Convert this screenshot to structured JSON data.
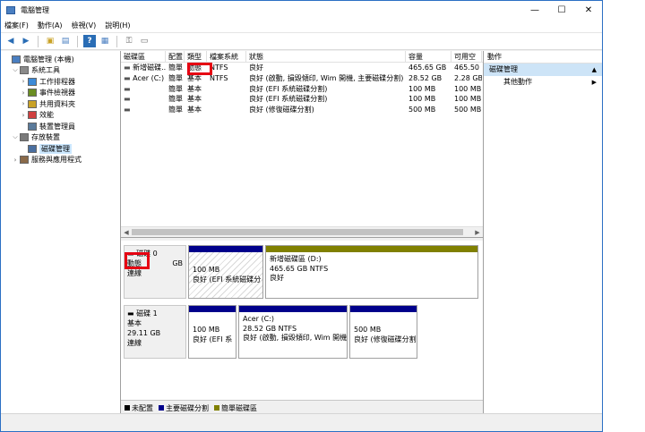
{
  "window": {
    "title": "電腦管理"
  },
  "menu": [
    "檔案(F)",
    "動作(A)",
    "檢視(V)",
    "說明(H)"
  ],
  "tree": [
    {
      "label": "電腦管理 (本機)",
      "arrow": "",
      "indent": 0,
      "icon": "computer-management-icon"
    },
    {
      "label": "系統工具",
      "arrow": "⌵",
      "indent": 1,
      "icon": "tools-icon"
    },
    {
      "label": "工作排程器",
      "arrow": "›",
      "indent": 2,
      "icon": "clock-icon"
    },
    {
      "label": "事件檢視器",
      "arrow": "›",
      "indent": 2,
      "icon": "event-viewer-icon"
    },
    {
      "label": "共用資料夾",
      "arrow": "›",
      "indent": 2,
      "icon": "shared-folder-icon"
    },
    {
      "label": "效能",
      "arrow": "›",
      "indent": 2,
      "icon": "performance-icon"
    },
    {
      "label": "裝置管理員",
      "arrow": "",
      "indent": 2,
      "icon": "device-manager-icon"
    },
    {
      "label": "存放裝置",
      "arrow": "⌵",
      "indent": 1,
      "icon": "storage-icon"
    },
    {
      "label": "磁碟管理",
      "arrow": "",
      "indent": 2,
      "icon": "disk-management-icon"
    },
    {
      "label": "服務與應用程式",
      "arrow": "›",
      "indent": 1,
      "icon": "services-icon"
    }
  ],
  "table": {
    "headers": [
      "磁碟區",
      "配置",
      "類型",
      "檔案系統",
      "狀態",
      "容量",
      "可用空"
    ],
    "rows": [
      [
        "新增磁碟...",
        "簡單",
        "動態",
        "NTFS",
        "良好",
        "465.65 GB",
        "465.50 G"
      ],
      [
        "Acer (C:)",
        "簡單",
        "基本",
        "NTFS",
        "良好 (啟動, 損毀傾印, Wim 開機, 主要磁碟分割)",
        "28.52 GB",
        "2.28 GB"
      ],
      [
        "",
        "簡單",
        "基本",
        "",
        "良好 (EFI 系統磁碟分割)",
        "100 MB",
        "100 MB"
      ],
      [
        "",
        "簡單",
        "基本",
        "",
        "良好 (EFI 系統磁碟分割)",
        "100 MB",
        "100 MB"
      ],
      [
        "",
        "簡單",
        "基本",
        "",
        "良好 (修復磁碟分割)",
        "500 MB",
        "500 MB"
      ]
    ]
  },
  "disks": [
    {
      "name": "磁碟 0",
      "type": "動態",
      "size": "GB",
      "status": "連線",
      "partitions": [
        {
          "size": "100 MB",
          "fs": "",
          "status": "良好 (EFI 系統磁碟分",
          "name": ""
        },
        {
          "size": "465.65 GB NTFS",
          "fs": "",
          "status": "良好",
          "name": "新增磁碟區  (D:)"
        }
      ]
    },
    {
      "name": "磁碟 1",
      "type": "基本",
      "size": "29.11 GB",
      "status": "連線",
      "partitions": [
        {
          "size": "100 MB",
          "status": "良好 (EFI 系",
          "name": ""
        },
        {
          "size": "28.52 GB NTFS",
          "status": "良好 (啟動, 損毀傾印, Wim 開機",
          "name": "Acer  (C:)"
        },
        {
          "size": "500 MB",
          "status": "良好 (修復磁碟分割",
          "name": ""
        }
      ]
    }
  ],
  "legend": [
    {
      "label": "未配置",
      "color": "#000000"
    },
    {
      "label": "主要磁碟分割",
      "color": "#00008b"
    },
    {
      "label": "簡單磁碟區",
      "color": "#808000"
    }
  ],
  "actions": {
    "header": "動作",
    "section": "磁碟管理",
    "item": "其他動作"
  },
  "colors": {
    "primary": "#00008b",
    "simple": "#808000",
    "highlight": "#e60012"
  }
}
